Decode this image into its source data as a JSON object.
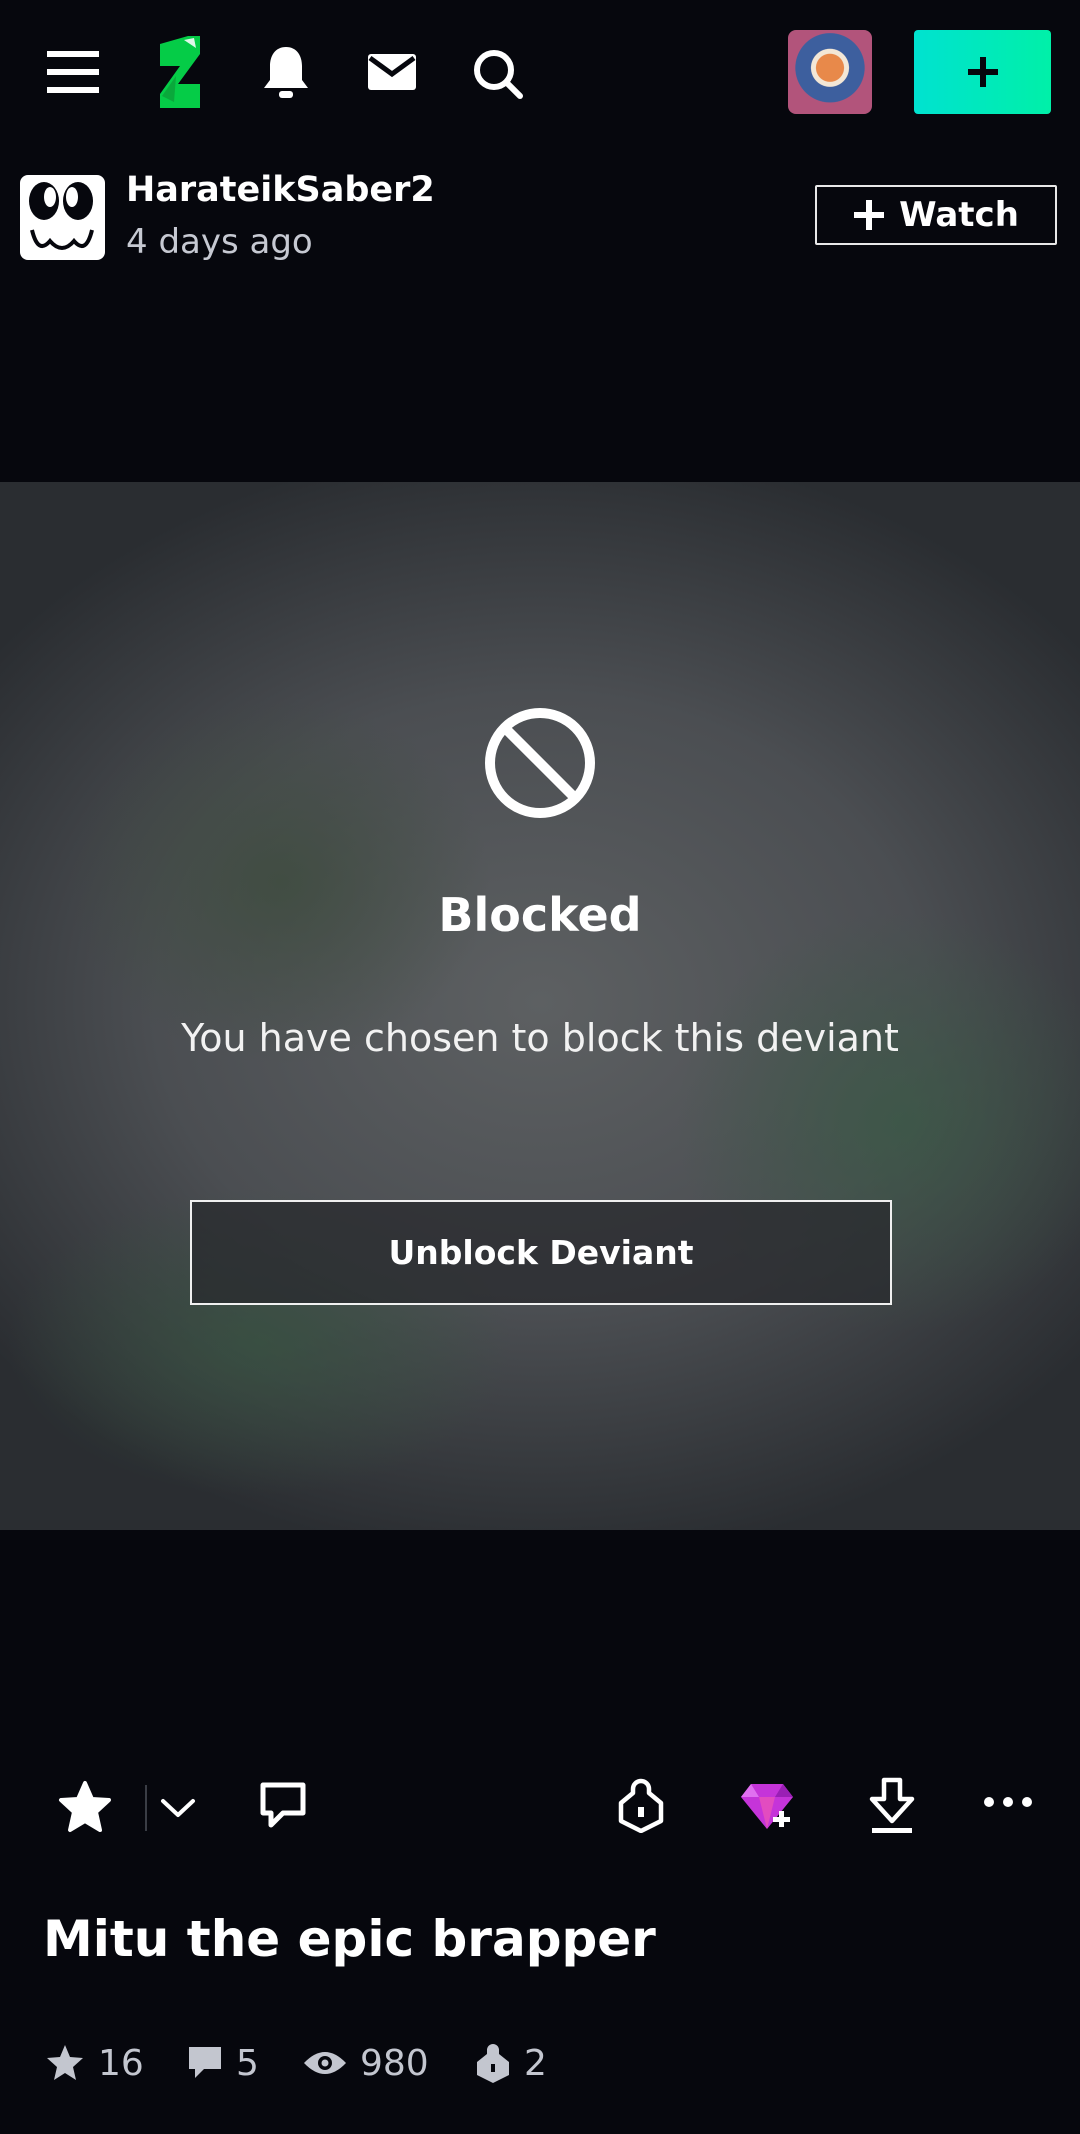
{
  "topbar": {
    "icons": [
      "menu-icon",
      "deviantart-logo",
      "bell-icon",
      "mail-icon",
      "search-icon"
    ],
    "create_label": "+"
  },
  "post": {
    "username": "HarateikSaber2",
    "timestamp": "4 days ago",
    "watch_label": "Watch"
  },
  "blocked": {
    "title": "Blocked",
    "message": "You have chosen to block this deviant",
    "unblock_label": "Unblock Deviant"
  },
  "actions": {
    "icons": [
      "star-icon",
      "chevron-down-icon",
      "comment-icon",
      "lock-badge-icon",
      "gem-icon",
      "download-icon",
      "more-icon"
    ]
  },
  "deviation": {
    "title": "Mitu the epic brapper",
    "stats": {
      "favourites": "16",
      "comments": "5",
      "views": "980",
      "collections": "2"
    }
  },
  "colors": {
    "background": "#06070d",
    "accent_start": "#00e2d0",
    "accent_end": "#00f0a8",
    "logo_green": "#05cc47"
  }
}
